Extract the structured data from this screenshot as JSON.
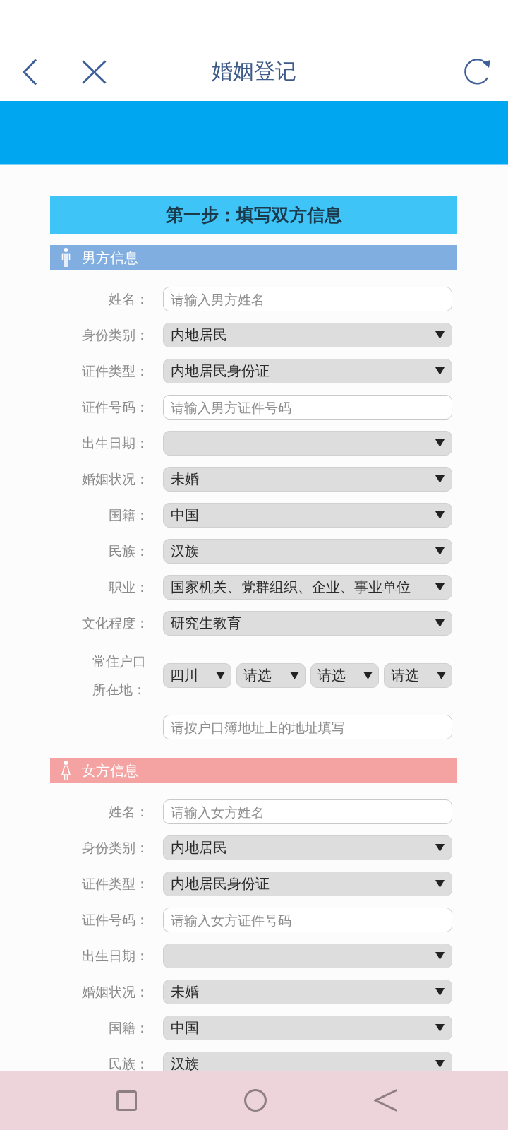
{
  "top_bar": {
    "title": "婚姻登记"
  },
  "step": {
    "title": "第一步：填写双方信息"
  },
  "sections": [
    {
      "kind": "male",
      "title": "男方信息",
      "fields": [
        {
          "kind": "input",
          "label": "姓名：",
          "placeholder": "请输入男方姓名"
        },
        {
          "kind": "select",
          "label": "身份类别：",
          "value": "内地居民"
        },
        {
          "kind": "select",
          "label": "证件类型：",
          "value": "内地居民身份证"
        },
        {
          "kind": "input",
          "label": "证件号码：",
          "placeholder": "请输入男方证件号码"
        },
        {
          "kind": "select",
          "label": "出生日期："
        },
        {
          "kind": "select",
          "label": "婚姻状况：",
          "value": "未婚"
        },
        {
          "kind": "select",
          "label": "国籍：",
          "value": "中国"
        },
        {
          "kind": "select",
          "label": "民族：",
          "value": "汉族"
        },
        {
          "kind": "select",
          "label": "职业：",
          "value": "国家机关、党群组织、企业、事业单位"
        },
        {
          "kind": "select",
          "label": "文化程度：",
          "value": "研究生教育"
        },
        {
          "kind": "region",
          "label": "常住户口所在地：",
          "selects": [
            {
              "value": "四川"
            },
            {
              "value": "请选"
            },
            {
              "value": "请选"
            },
            {
              "value": "请选"
            }
          ]
        },
        {
          "kind": "input",
          "placeholder": "请按户口簿地址上的地址填写"
        }
      ]
    },
    {
      "kind": "female",
      "title": "女方信息",
      "fields": [
        {
          "kind": "input",
          "label": "姓名：",
          "placeholder": "请输入女方姓名"
        },
        {
          "kind": "select",
          "label": "身份类别：",
          "value": "内地居民"
        },
        {
          "kind": "select",
          "label": "证件类型：",
          "value": "内地居民身份证"
        },
        {
          "kind": "input",
          "label": "证件号码：",
          "placeholder": "请输入女方证件号码"
        },
        {
          "kind": "select",
          "label": "出生日期："
        },
        {
          "kind": "select",
          "label": "婚姻状况：",
          "value": "未婚"
        },
        {
          "kind": "select",
          "label": "国籍：",
          "value": "中国"
        },
        {
          "kind": "select",
          "label": "民族：",
          "value": "汉族"
        }
      ]
    }
  ]
}
